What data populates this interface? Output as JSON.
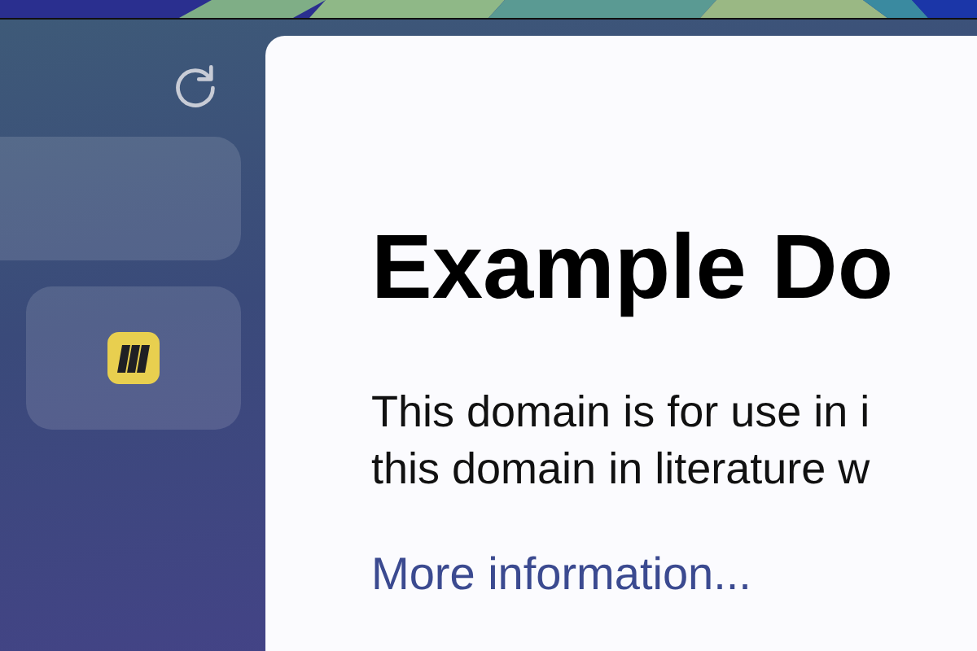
{
  "page": {
    "heading": "Example Do",
    "paragraph_lines": [
      "This domain is for use in i",
      "this domain in literature w"
    ],
    "link": "More information..."
  }
}
